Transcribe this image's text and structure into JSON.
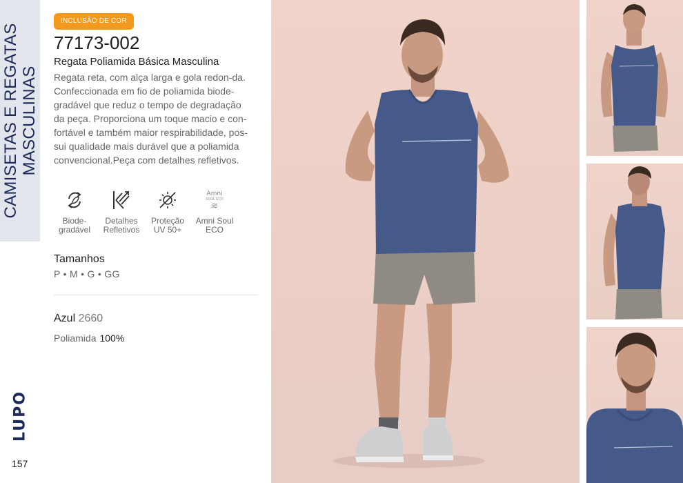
{
  "sidebar": {
    "category_title": "CAMISETAS E REGATAS MASCULINAS",
    "brand_logo": "LUPO",
    "page_number": "157"
  },
  "product": {
    "badge": "INCLUSÃO DE COR",
    "code": "77173-002",
    "name": "Regata Poliamida Básica Masculina",
    "description": "Regata reta, com alça larga e gola redon-da. Confeccionada em fio de poliamida biode-gradável que reduz o tempo de degradação da peça. Proporciona um toque macio e con-fortável e também maior respirabilidade, pos-sui qualidade mais durável que a poliamida convencional.Peça com detalhes refletivos.",
    "features": [
      {
        "icon": "biodegradable-icon",
        "label": "Biode-\ngradável"
      },
      {
        "icon": "reflective-icon",
        "label": "Detalhes\nRefletivos"
      },
      {
        "icon": "uv-protection-icon",
        "label": "Proteção\nUV 50+"
      },
      {
        "icon": "amni-soul-eco-icon",
        "label": "Amni Soul\nECO",
        "logo_lines": [
          "Amni",
          "SOUL ECO",
          "≋"
        ]
      }
    ],
    "sizes_title": "Tamanhos",
    "sizes": "P • M • G • GG",
    "color_name": "Azul",
    "color_code": "2660",
    "composition_material": "Poliamida",
    "composition_percent": "100%"
  },
  "colors": {
    "navy": "#1d2a5a",
    "badge_orange": "#f39a1d",
    "tank_blue": "#465a8a",
    "shorts_grey": "#8f8a84",
    "backdrop_pink": "#eccfc6"
  }
}
